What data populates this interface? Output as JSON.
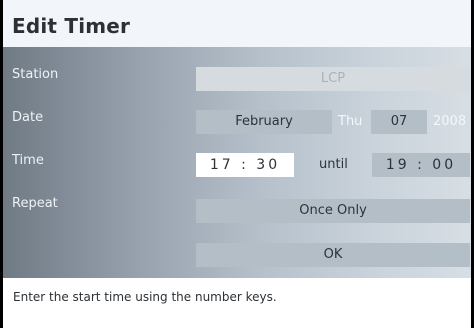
{
  "dialog": {
    "title": "Edit Timer"
  },
  "form": {
    "station": {
      "label": "Station",
      "value": "LCP"
    },
    "date": {
      "label": "Date",
      "month": "February",
      "weekday": "Thu",
      "day": "07",
      "year": "2008"
    },
    "time": {
      "label": "Time",
      "start": "17 : 30",
      "until_label": "until",
      "end": "19 : 00"
    },
    "repeat": {
      "label": "Repeat",
      "value": "Once Only"
    },
    "ok_label": "OK"
  },
  "help_text": "Enter the start time using the number keys."
}
